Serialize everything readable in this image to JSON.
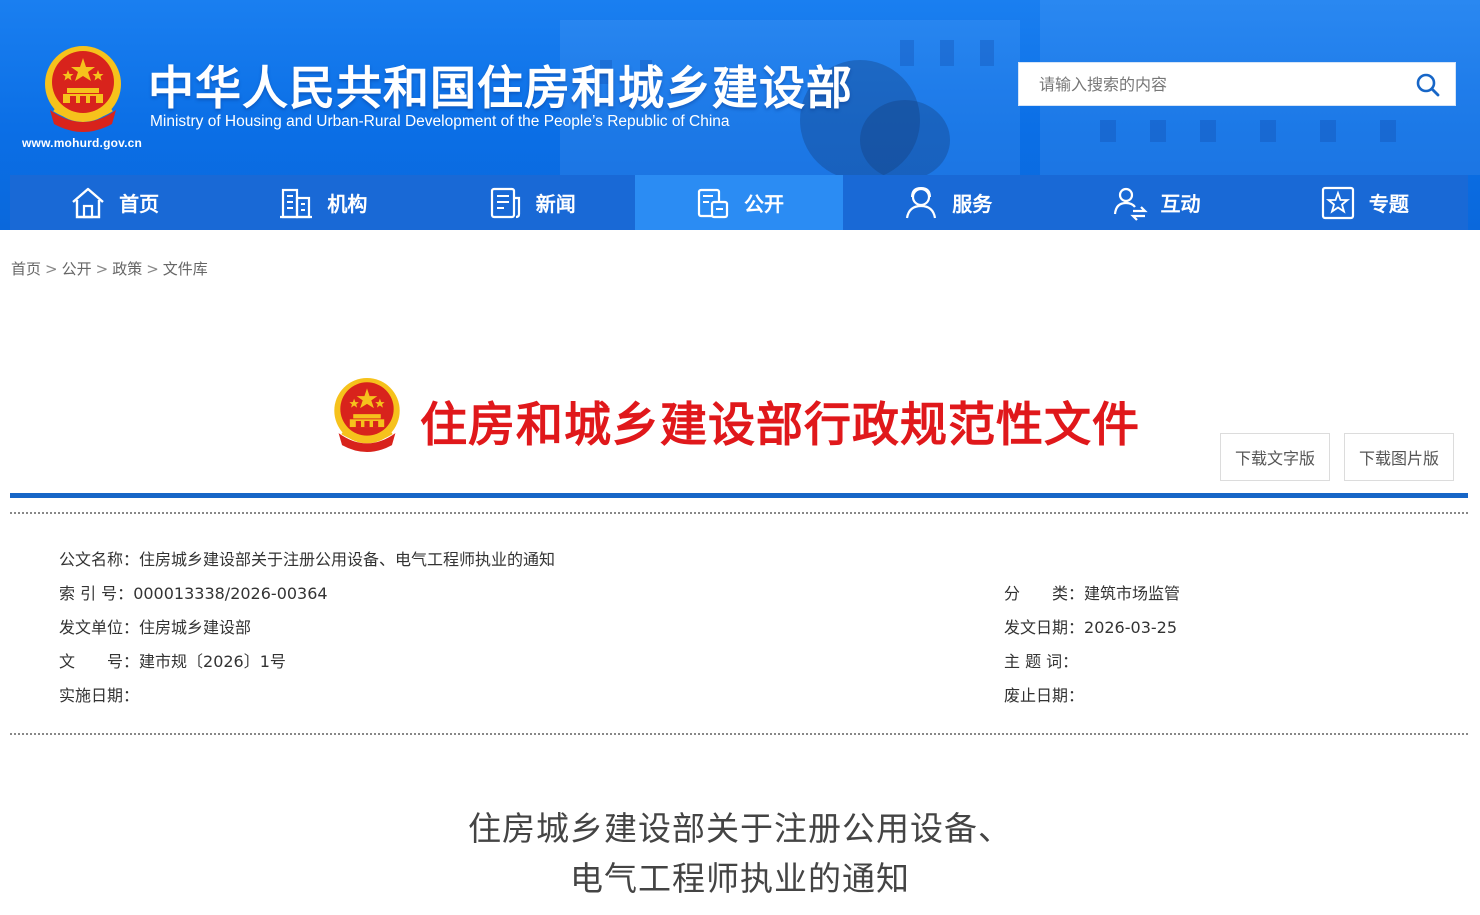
{
  "header": {
    "site_title": "中华人民共和国住房和城乡建设部",
    "site_subtitle": "Ministry of Housing and Urban-Rural Development of the People’s Republic of China",
    "site_url": "www.mohurd.gov.cn",
    "search_placeholder": "请输入搜索的内容",
    "search_icon": "search-icon",
    "emblem_icon": "national-emblem-icon"
  },
  "nav": {
    "items": [
      {
        "label": "首页",
        "icon": "home-icon"
      },
      {
        "label": "机构",
        "icon": "building-icon"
      },
      {
        "label": "新闻",
        "icon": "news-icon"
      },
      {
        "label": "公开",
        "icon": "disclosure-icon",
        "active": true
      },
      {
        "label": "服务",
        "icon": "service-icon"
      },
      {
        "label": "互动",
        "icon": "interaction-icon"
      },
      {
        "label": "专题",
        "icon": "star-topic-icon"
      }
    ]
  },
  "breadcrumb": {
    "items": [
      "首页",
      "公开",
      "政策",
      "文件库"
    ],
    "separator": ">"
  },
  "doc_banner": {
    "title": "住房和城乡建设部行政规范性文件",
    "download_text": "下载文字版",
    "download_image": "下载图片版"
  },
  "meta": {
    "doc_name_label": "公文名称：",
    "doc_name": "住房城乡建设部关于注册公用设备、电气工程师执业的通知",
    "index_label": "索 引 号：",
    "index": "000013338/2026-00364",
    "category_label": "分　　类：",
    "category": "建筑市场监管",
    "issuer_label": "发文单位：",
    "issuer": "住房城乡建设部",
    "issue_date_label": "发文日期：",
    "issue_date": "2026-03-25",
    "doc_no_label": "文　　号：",
    "doc_no": "建市规〔2026〕1号",
    "keywords_label": "主 题 词：",
    "keywords": "",
    "effective_label": "实施日期：",
    "effective": "",
    "abolish_label": "废止日期：",
    "abolish": ""
  },
  "document": {
    "title_line1": "住房城乡建设部关于注册公用设备、",
    "title_line2": "电气工程师执业的通知"
  },
  "colors": {
    "header_blue": "#0b6fe6",
    "nav_blue": "#1969d6",
    "nav_active": "#2b8cf3",
    "banner_red": "#e0181b",
    "rule_blue": "#1766c7"
  }
}
